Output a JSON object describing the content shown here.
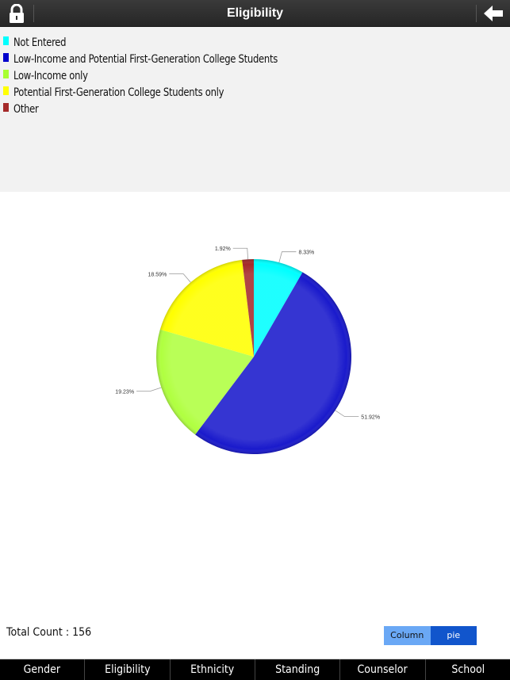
{
  "header": {
    "title": "Eligibility",
    "left_icon": "lock-icon",
    "right_icon": "back-arrow-icon"
  },
  "chart_data": {
    "type": "pie",
    "title": "Eligibility",
    "categories": [
      "Not Entered",
      "Low-Income and Potential First-Generation College Students",
      "Low-Income only",
      "Potential First-Generation College Students only",
      "Other"
    ],
    "values": [
      8.33,
      51.92,
      19.23,
      18.59,
      1.92
    ],
    "data_labels": [
      "8.33%",
      "51.92%",
      "19.23%",
      "18.59%",
      "1.92%"
    ],
    "colors": [
      "#00ffff",
      "#1a1acc",
      "#b0ff40",
      "#ffff00",
      "#a52a2a"
    ],
    "start_angle": "top, clockwise",
    "legend": {
      "placement": "top-left",
      "items": [
        {
          "label": "Not Entered",
          "color": "#00ffff"
        },
        {
          "label": "Low-Income and Potential First-Generation College Students",
          "color": "#0000cc"
        },
        {
          "label": "Low-Income only",
          "color": "#a8ff30"
        },
        {
          "label": "Potential First-Generation College Students only",
          "color": "#ffff00"
        },
        {
          "label": "Other",
          "color": "#a52a2a"
        }
      ]
    }
  },
  "footer": {
    "total_count": "Total Count : 156",
    "chart_toggle": {
      "column_label": "Column",
      "pie_label": "pie",
      "selected": "pie"
    }
  },
  "tabs": [
    {
      "label": "Gender"
    },
    {
      "label": "Eligibility"
    },
    {
      "label": "Ethnicity"
    },
    {
      "label": "Standing"
    },
    {
      "label": "Counselor"
    },
    {
      "label": "School"
    }
  ]
}
